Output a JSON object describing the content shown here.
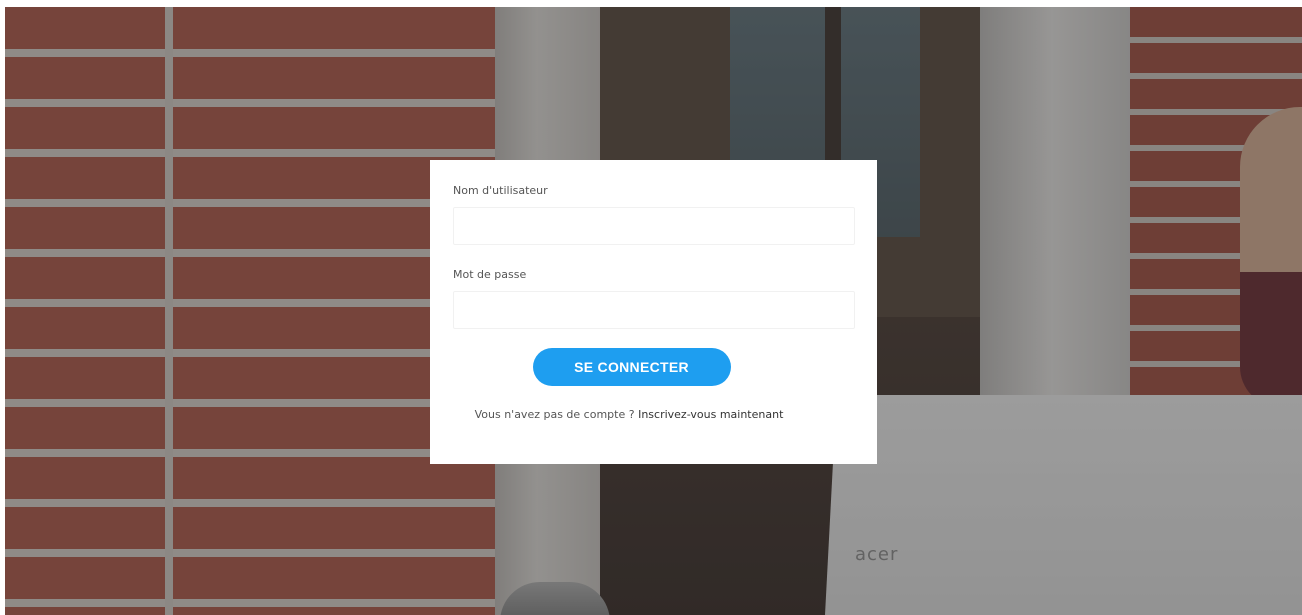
{
  "login": {
    "username_label": "Nom d'utilisateur",
    "username_value": "",
    "password_label": "Mot de passe",
    "password_value": "",
    "submit_label": "SE CONNECTER",
    "signup_prompt": "Vous n'avez pas de compte ?",
    "signup_link": "Inscrivez-vous maintenant"
  },
  "background": {
    "laptop_brand": "acer"
  },
  "colors": {
    "button_bg": "#1e9ef0",
    "button_text": "#ffffff",
    "card_bg": "#ffffff"
  }
}
